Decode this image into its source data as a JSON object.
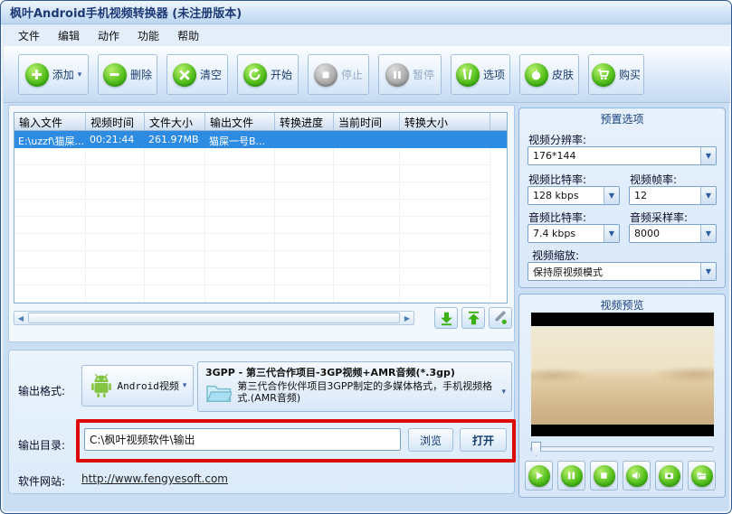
{
  "window": {
    "title": "枫叶Android手机视频转换器  (未注册版本)"
  },
  "menu": {
    "items": [
      "文件",
      "编辑",
      "动作",
      "功能",
      "帮助"
    ]
  },
  "toolbar": {
    "buttons": [
      {
        "label": "添加",
        "icon": "plus-icon",
        "enabled": true,
        "has_dropdown": true
      },
      {
        "label": "删除",
        "icon": "minus-icon",
        "enabled": true
      },
      {
        "label": "清空",
        "icon": "clear-x-icon",
        "enabled": true
      },
      {
        "label": "开始",
        "icon": "start-circular-arrow-icon",
        "enabled": true
      },
      {
        "label": "停止",
        "icon": "stop-square-icon",
        "enabled": false
      },
      {
        "label": "暂停",
        "icon": "pause-icon",
        "enabled": false
      },
      {
        "label": "选项",
        "icon": "tools-icon",
        "enabled": true
      },
      {
        "label": "皮肤",
        "icon": "apple-icon",
        "enabled": true
      },
      {
        "label": "购买",
        "icon": "cart-icon",
        "enabled": true
      }
    ]
  },
  "file_table": {
    "headers": [
      "输入文件",
      "视频时间",
      "文件大小",
      "输出文件",
      "转换进度",
      "当前时间",
      "转换大小"
    ],
    "rows": [
      {
        "selected": true,
        "cells": [
          "E:\\uzzf\\猫屎...",
          "00:21:44",
          "261.97MB",
          "猫屎一号B...",
          "",
          "",
          ""
        ]
      }
    ]
  },
  "preset": {
    "title": "预置选项",
    "resolution_label": "视频分辨率:",
    "resolution_value": "176*144",
    "video_bitrate_label": "视频比特率:",
    "video_bitrate_value": "128 kbps",
    "framerate_label": "视频帧率:",
    "framerate_value": "12",
    "audio_bitrate_label": "音频比特率:",
    "audio_bitrate_value": "7.4 kbps",
    "samplerate_label": "音频采样率:",
    "samplerate_value": "8000",
    "scale_label": "视频缩放:",
    "scale_value": "保持原视频模式"
  },
  "preview": {
    "title": "视频预览"
  },
  "output": {
    "format_label": "输出格式:",
    "format_button_label": "Android视频",
    "format_title": "3GPP - 第三代合作项目-3GP视频+AMR音频(*.3gp)",
    "format_desc": "第三代合作伙伴项目3GPP制定的多媒体格式，手机视频格式.(AMR音频)",
    "dir_label": "输出目录:",
    "dir_value": "C:\\枫叶视频软件\\输出",
    "browse_label": "浏览",
    "open_label": "打开",
    "website_label": "软件网站:",
    "website_url": "http://www.fengyesoft.com"
  },
  "colors": {
    "accent_green": "#3fae12",
    "selected_row_blue": "#2d8ce2",
    "annotation_red": "#dd0a0a"
  }
}
